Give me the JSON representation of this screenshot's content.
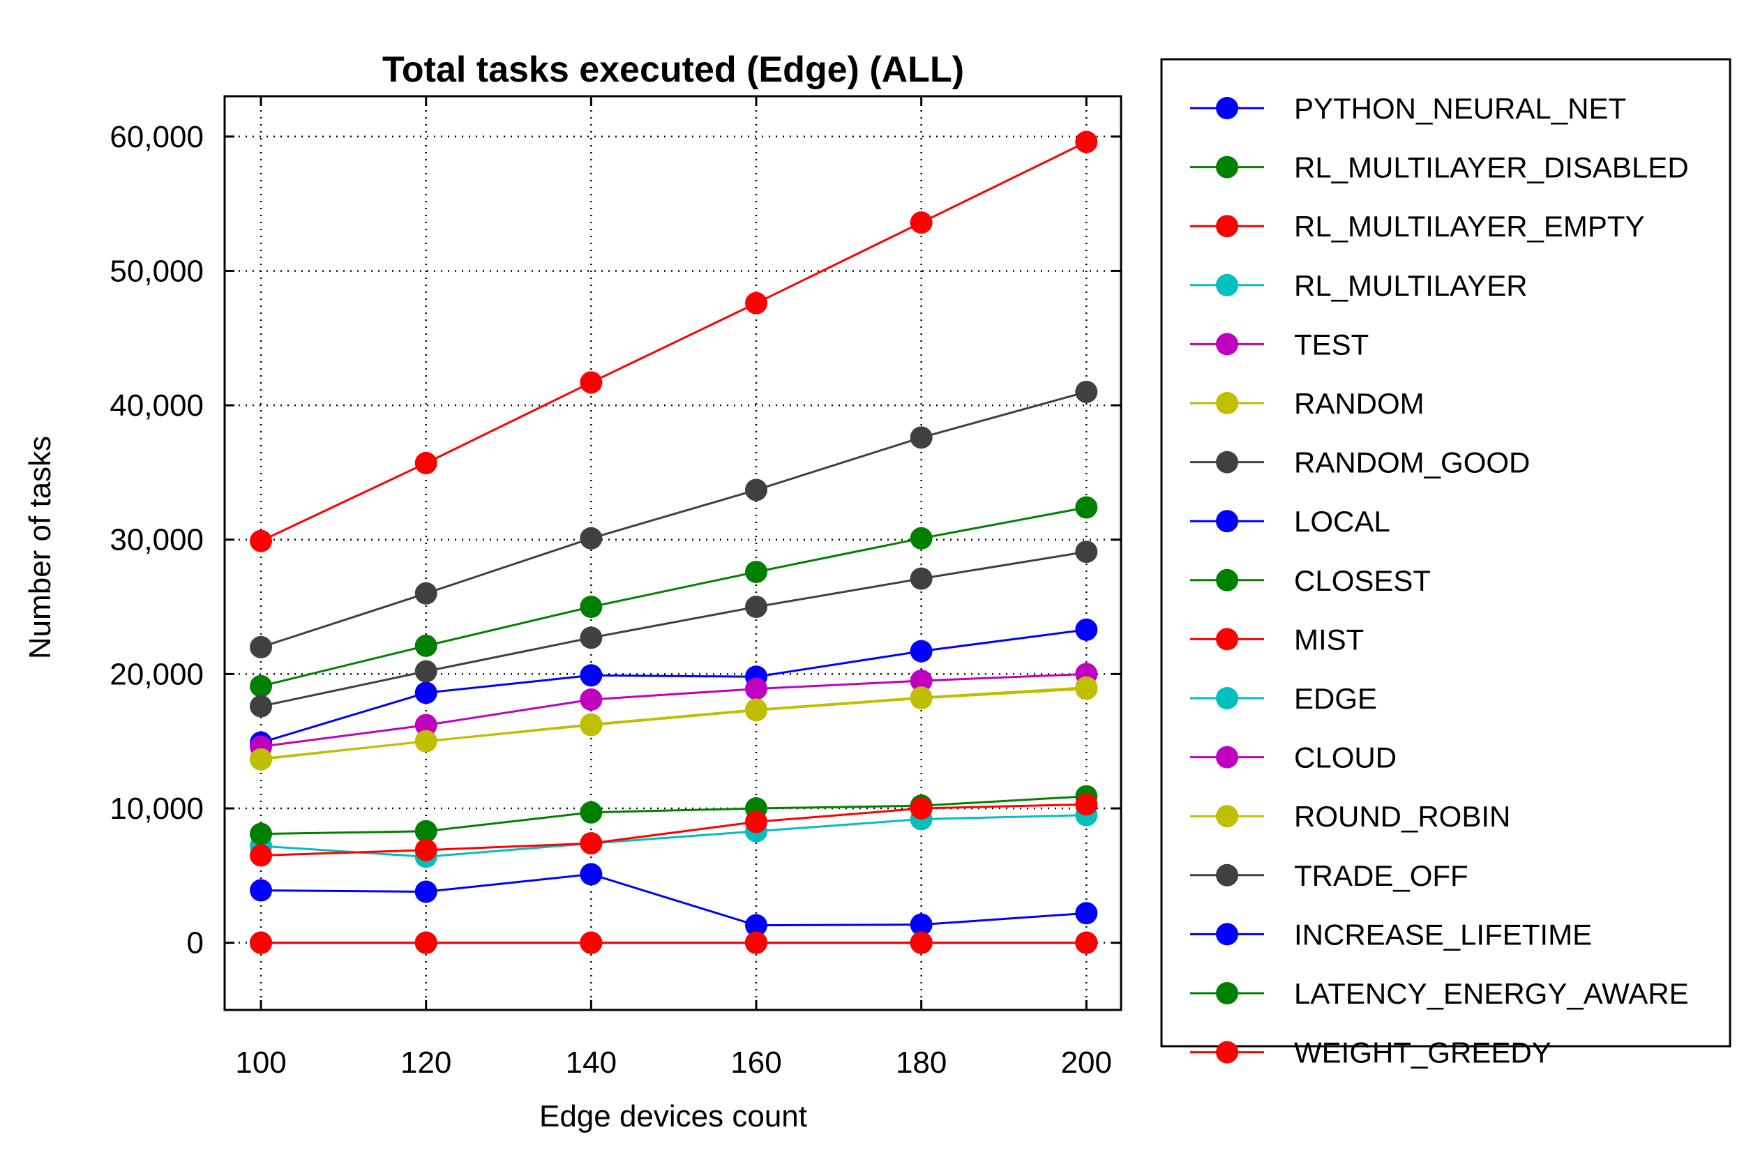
{
  "chart_data": {
    "type": "line",
    "title": "Total tasks executed (Edge) (ALL)",
    "xlabel": "Edge devices count",
    "ylabel": "Number of tasks",
    "x": [
      100,
      120,
      140,
      160,
      180,
      200
    ],
    "xticks": [
      "100",
      "120",
      "140",
      "160",
      "180",
      "200"
    ],
    "xlim": [
      95.6,
      204.2
    ],
    "ylim": [
      -5000,
      63000
    ],
    "yticks": [
      0,
      10000,
      20000,
      30000,
      40000,
      50000,
      60000
    ],
    "ytick_labels": [
      "0",
      "10,000",
      "20,000",
      "30,000",
      "40,000",
      "50,000",
      "60,000"
    ],
    "grid": true,
    "legend_position": "outside-right",
    "series": [
      {
        "name": "PYTHON_NEURAL_NET",
        "color": "#0000ff",
        "values": [
          14900,
          18600,
          19900,
          19800,
          21700,
          23300
        ]
      },
      {
        "name": "RL_MULTILAYER_DISABLED",
        "color": "#008000",
        "values": [
          19100,
          22100,
          25000,
          27600,
          30100,
          32400
        ]
      },
      {
        "name": "RL_MULTILAYER_EMPTY",
        "color": "#ff0000",
        "values": [
          29900,
          35700,
          41700,
          47600,
          53600,
          59600
        ]
      },
      {
        "name": "RL_MULTILAYER",
        "color": "#00bfbf",
        "values": [
          7200,
          6400,
          7400,
          8300,
          9200,
          9500
        ]
      },
      {
        "name": "TEST",
        "color": "#bf00bf",
        "values": [
          0,
          0,
          0,
          0,
          0,
          0
        ]
      },
      {
        "name": "RANDOM",
        "color": "#bfbf00",
        "values": [
          13700,
          15000,
          16200,
          17300,
          18200,
          18900
        ]
      },
      {
        "name": "RANDOM_GOOD",
        "color": "#404040",
        "values": [
          22000,
          26000,
          30100,
          33700,
          37600,
          41000
        ]
      },
      {
        "name": "LOCAL",
        "color": "#0000ff",
        "values": [
          3900,
          3800,
          5100,
          1300,
          1350,
          2200
        ]
      },
      {
        "name": "CLOSEST",
        "color": "#008000",
        "values": [
          8100,
          8300,
          9700,
          10000,
          10200,
          10900
        ]
      },
      {
        "name": "MIST",
        "color": "#ff0000",
        "values": [
          6500,
          6900,
          7400,
          9000,
          10000,
          10300
        ]
      },
      {
        "name": "EDGE",
        "color": "#00bfbf",
        "values": [
          0,
          0,
          0,
          0,
          0,
          0
        ]
      },
      {
        "name": "CLOUD",
        "color": "#bf00bf",
        "values": [
          14600,
          16200,
          18100,
          18900,
          19500,
          20000
        ]
      },
      {
        "name": "ROUND_ROBIN",
        "color": "#bfbf00",
        "values": [
          13650,
          15000,
          16250,
          17350,
          18250,
          19000
        ]
      },
      {
        "name": "TRADE_OFF",
        "color": "#404040",
        "values": [
          17600,
          20200,
          22700,
          25000,
          27100,
          29100
        ]
      },
      {
        "name": "INCREASE_LIFETIME",
        "color": "#0000ff",
        "values": [
          0,
          0,
          0,
          0,
          0,
          0
        ]
      },
      {
        "name": "LATENCY_ENERGY_AWARE",
        "color": "#008000",
        "values": [
          0,
          0,
          0,
          0,
          0,
          0
        ]
      },
      {
        "name": "WEIGHT_GREEDY",
        "color": "#ff0000",
        "values": [
          0,
          0,
          0,
          0,
          0,
          0
        ]
      }
    ]
  }
}
